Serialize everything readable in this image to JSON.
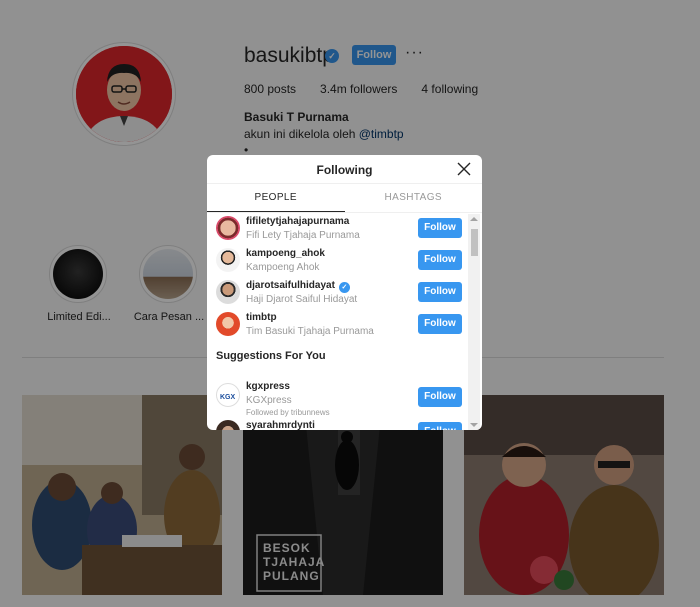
{
  "profile": {
    "username": "basukibtp",
    "follow_label": "Follow",
    "more_label": "···",
    "posts": "800 posts",
    "followers": "3.4m followers",
    "following": "4 following",
    "full_name": "Basuki T Purnama",
    "bio_prefix": "akun ini dikelola oleh ",
    "bio_mention": "@timbtp",
    "bio_dot": "•"
  },
  "highlights": [
    {
      "label": "Limited Edi..."
    },
    {
      "label": "Cara Pesan ..."
    }
  ],
  "posts": [
    {
      "text": ""
    },
    {
      "text": "BESOK TJAHAJA PULANG"
    },
    {
      "text": ""
    }
  ],
  "modal": {
    "title": "Following",
    "tabs": [
      "PEOPLE",
      "HASHTAGS"
    ],
    "active_tab": "PEOPLE",
    "following": [
      {
        "username": "fifiletytjahajapurnama",
        "full_name": "Fifi Lety Tjahaja Purnama",
        "button": "Follow",
        "verified": false
      },
      {
        "username": "kampoeng_ahok",
        "full_name": "Kampoeng Ahok",
        "button": "Follow",
        "verified": false
      },
      {
        "username": "djarotsaifulhidayat",
        "full_name": "Haji Djarot Saiful Hidayat",
        "button": "Follow",
        "verified": true
      },
      {
        "username": "timbtp",
        "full_name": "Tim Basuki Tjahaja Purnama",
        "button": "Follow",
        "verified": false
      }
    ],
    "suggestions_title": "Suggestions For You",
    "suggestions": [
      {
        "username": "kgxpress",
        "full_name": "KGXpress",
        "subtitle": "Followed by tribunnews",
        "button": "Follow"
      },
      {
        "username": "syarahmrdynti",
        "full_name": "",
        "subtitle": "",
        "button": "Follow"
      }
    ]
  },
  "colors": {
    "accent": "#3897f0",
    "overlay": "rgba(0,0,0,0.42)",
    "avatar_red": "#e0262c"
  }
}
